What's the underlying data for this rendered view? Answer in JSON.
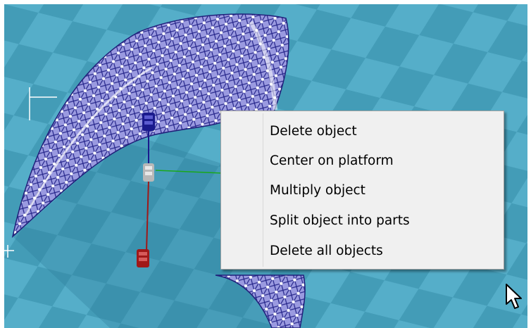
{
  "context_menu": {
    "items": [
      {
        "label": "Delete object"
      },
      {
        "label": "Center on platform"
      },
      {
        "label": "Multiply object"
      },
      {
        "label": "Split object into parts"
      },
      {
        "label": "Delete all objects"
      }
    ]
  },
  "colors": {
    "platform_light": "#5bb9d6",
    "platform_dark": "#3f98b4",
    "mesh_fill": "#8f8fd6",
    "mesh_edge": "#26268a",
    "gizmo_z": "#1a1a8c",
    "gizmo_y": "#a01818",
    "gizmo_x": "#1aa81a",
    "menu_bg": "#f0f0f0",
    "menu_border": "#a0a0a0"
  },
  "icons": {
    "gizmo_top": "scale-handle-icon",
    "gizmo_center": "move-handle-icon",
    "gizmo_bottom": "rotate-handle-icon",
    "pointer": "arrow-cursor-icon"
  }
}
